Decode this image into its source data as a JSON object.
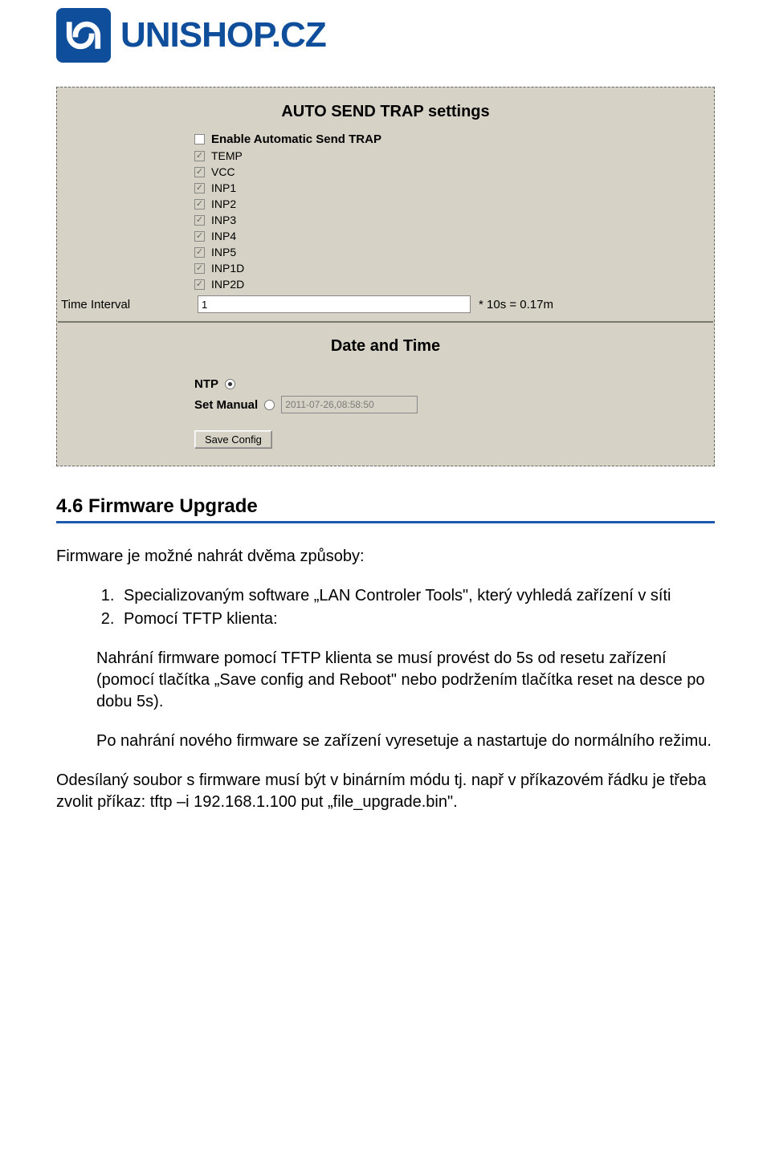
{
  "logo": {
    "text_main": "UNISHOP",
    "text_suffix": ".CZ"
  },
  "panel": {
    "section1_title": "AUTO SEND TRAP settings",
    "checkboxes": [
      {
        "label": "Enable Automatic Send TRAP",
        "bold": true,
        "checked": false,
        "disabled": false
      },
      {
        "label": "TEMP",
        "bold": false,
        "checked": true,
        "disabled": true
      },
      {
        "label": "VCC",
        "bold": false,
        "checked": true,
        "disabled": true
      },
      {
        "label": "INP1",
        "bold": false,
        "checked": true,
        "disabled": true
      },
      {
        "label": "INP2",
        "bold": false,
        "checked": true,
        "disabled": true
      },
      {
        "label": "INP3",
        "bold": false,
        "checked": true,
        "disabled": true
      },
      {
        "label": "INP4",
        "bold": false,
        "checked": true,
        "disabled": true
      },
      {
        "label": "INP5",
        "bold": false,
        "checked": true,
        "disabled": true
      },
      {
        "label": "INP1D",
        "bold": false,
        "checked": true,
        "disabled": true
      },
      {
        "label": "INP2D",
        "bold": false,
        "checked": true,
        "disabled": true
      }
    ],
    "interval_label": "Time Interval",
    "interval_value": "1",
    "interval_hint": "* 10s = 0.17m",
    "section2_title": "Date and Time",
    "ntp_label": "NTP",
    "manual_label": "Set Manual",
    "datetime_value": "2011-07-26,08:58:50",
    "save_button": "Save Config"
  },
  "content": {
    "heading": "4.6 Firmware Upgrade",
    "intro": "Firmware je možné nahrát dvěma způsoby:",
    "li1": "Specializovaným software „LAN Controler Tools\", který vyhledá zařízení v síti",
    "li2": "Pomocí TFTP klienta:",
    "para1": "Nahrání firmware pomocí TFTP klienta se musí provést do 5s od resetu zařízení (pomocí tlačítka „Save config and Reboot\" nebo podržením tlačítka reset na desce po dobu 5s).",
    "para2": "Po nahrání nového firmware se zařízení vyresetuje a nastartuje do normálního režimu.",
    "para3": "Odesílaný soubor s firmware musí být v binárním módu tj. např v příkazovém řádku je třeba zvolit příkaz: tftp –i 192.168.1.100 put „file_upgrade.bin\"."
  }
}
